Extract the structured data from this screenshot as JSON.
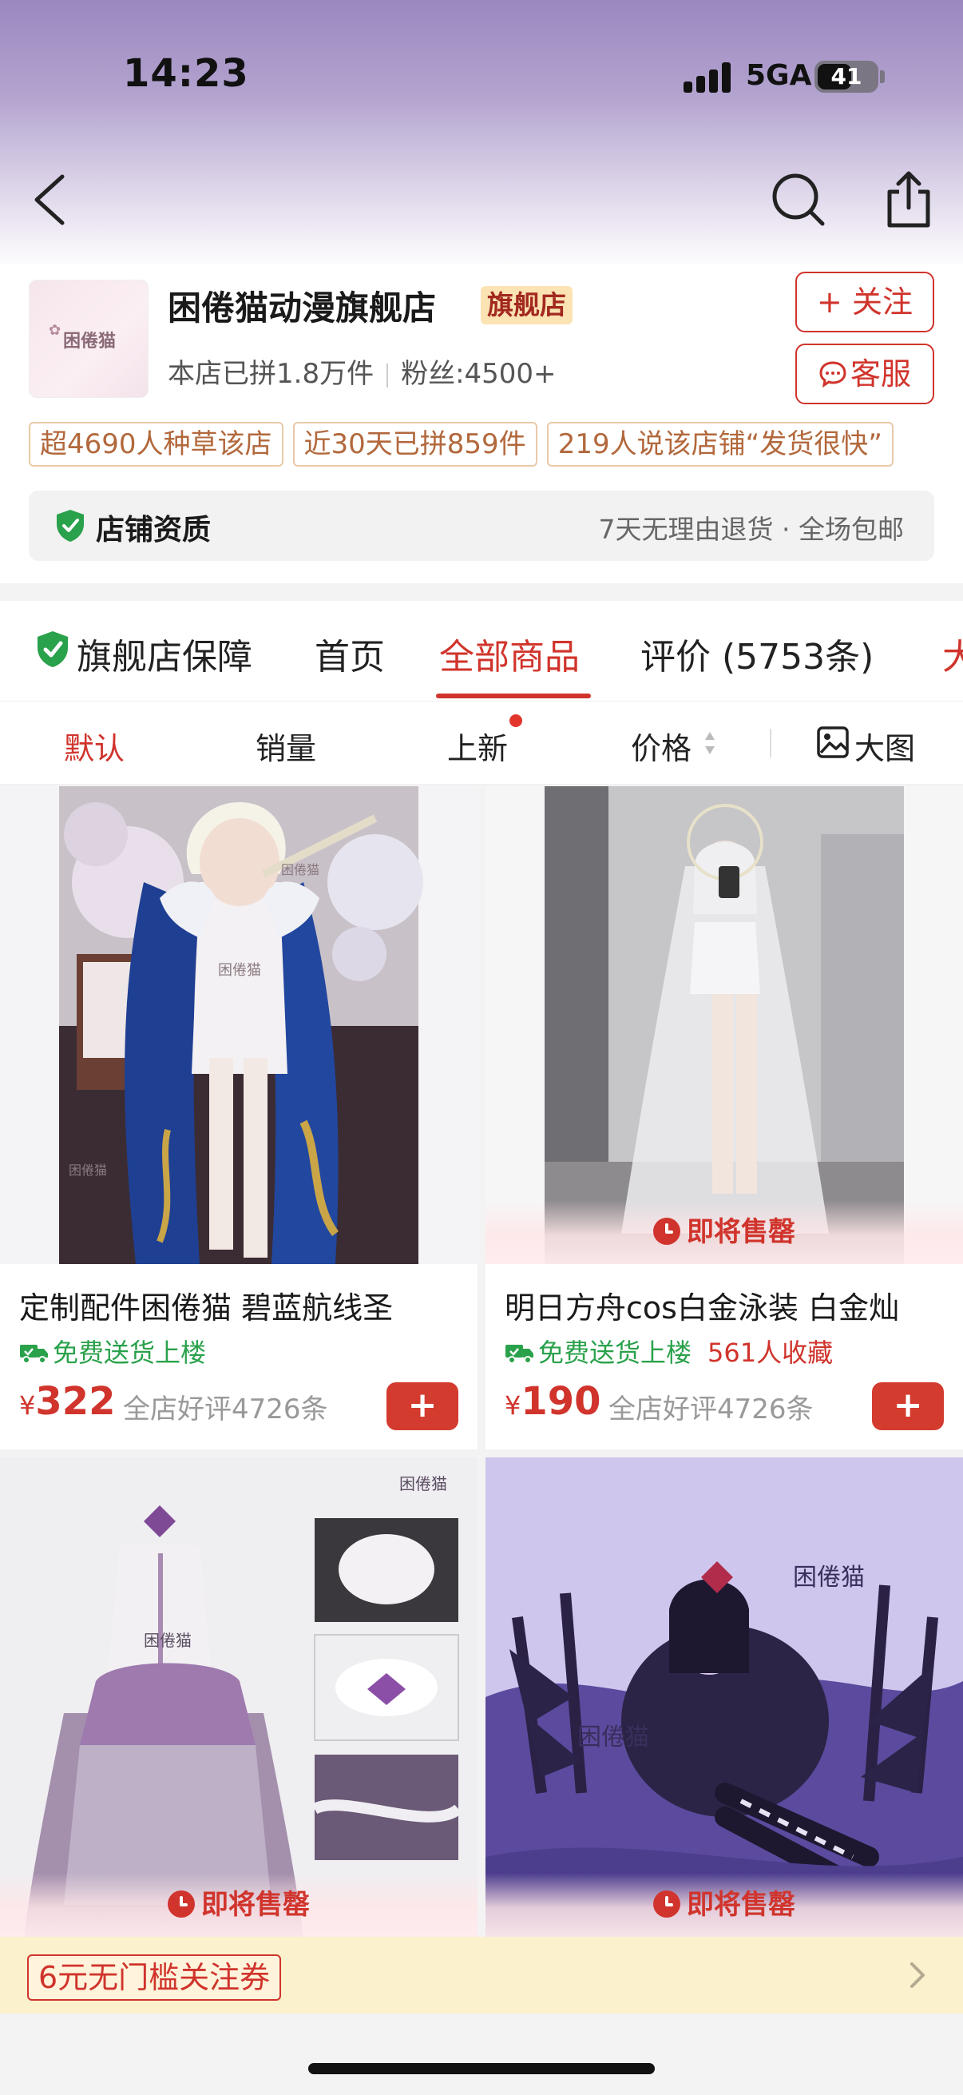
{
  "status_bar": {
    "time": "14:23",
    "network": "5GA",
    "battery": "41"
  },
  "store": {
    "logo_text": "困倦猫",
    "name": "困倦猫动漫旗舰店",
    "badge": "旗舰店",
    "sold": "本店已拼1.8万件",
    "fans": "粉丝:4500+",
    "follow_label": "+ 关注",
    "service_label": "客服",
    "tags": [
      "超4690人种草该店",
      "近30天已拼859件",
      "219人说该店铺“发货很快”"
    ],
    "qualification": "店铺资质",
    "policy": "7天无理由退货 · 全场包邮"
  },
  "tabs": [
    {
      "label": "旗舰店保障"
    },
    {
      "label": "首页"
    },
    {
      "label": "全部商品"
    },
    {
      "label": "评价 (5753条)"
    },
    {
      "label": "大"
    }
  ],
  "sort": {
    "default": "默认",
    "sales": "销量",
    "new": "上新",
    "price": "价格",
    "big_image": "大图"
  },
  "products": [
    {
      "title": "定制配件困倦猫 碧蓝航线圣",
      "shipping": "免费送货上楼",
      "favorites": "",
      "price_symbol": "¥",
      "price": "322",
      "review": "全店好评4726条",
      "watermark": "困倦猫"
    },
    {
      "title": "明日方舟cos白金泳装 白金灿",
      "shipping": "免费送货上楼",
      "favorites": "561人收藏",
      "price_symbol": "¥",
      "price": "190",
      "review": "全店好评4726条",
      "soon": "即将售罄",
      "watermark": "困倦猫"
    },
    {
      "soon": "即将售罄",
      "watermark": "困倦猫"
    },
    {
      "soon": "即将售罄",
      "watermark": "困倦猫"
    }
  ],
  "add_label": "+",
  "coupon": "6元无门槛关注券",
  "colors": {
    "accent": "#d0342c",
    "green": "#2aa14b",
    "coupon_bg": "#fbf1cc"
  }
}
